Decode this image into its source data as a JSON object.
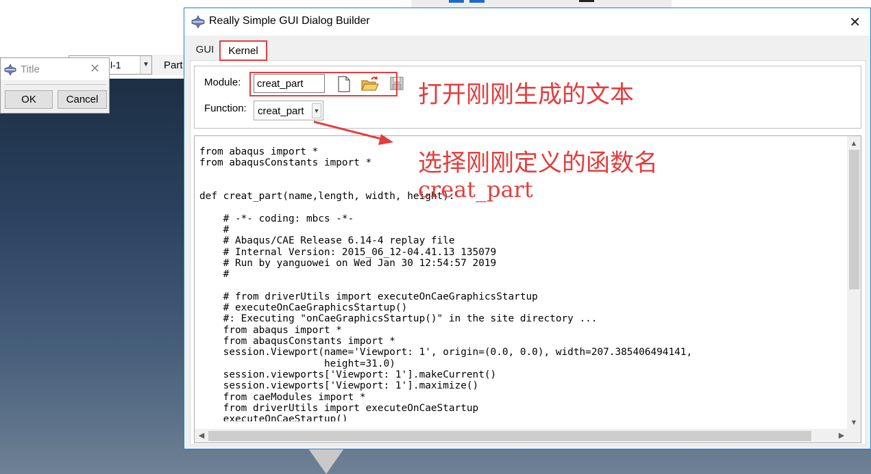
{
  "background": {
    "combo_value": "l-1",
    "part_label": "Part"
  },
  "small_dialog": {
    "title": "Title",
    "close_glyph": "✕",
    "ok_label": "OK",
    "cancel_label": "Cancel"
  },
  "main_dialog": {
    "title": "Really Simple GUI Dialog Builder",
    "close_glyph": "✕",
    "tabs": [
      {
        "label": "GUI",
        "active": false
      },
      {
        "label": "Kernel",
        "active": true
      }
    ],
    "module": {
      "label": "Module:",
      "value": "creat_part",
      "icons": [
        "new-file-icon",
        "open-folder-icon",
        "save-icon"
      ]
    },
    "function": {
      "label": "Function:",
      "selected": "creat_part"
    },
    "code_lines": [
      "from abaqus import *",
      "from abaqusConstants import *",
      "",
      "",
      "def creat_part(name,length, width, height):",
      "",
      "    # -*- coding: mbcs -*-",
      "    #",
      "    # Abaqus/CAE Release 6.14-4 replay file",
      "    # Internal Version: 2015_06_12-04.41.13 135079",
      "    # Run by yanguowei on Wed Jan 30 12:54:57 2019",
      "    #",
      "",
      "    # from driverUtils import executeOnCaeGraphicsStartup",
      "    # executeOnCaeGraphicsStartup()",
      "    #: Executing \"onCaeGraphicsStartup()\" in the site directory ...",
      "    from abaqus import *",
      "    from abaqusConstants import *",
      "    session.Viewport(name='Viewport: 1', origin=(0.0, 0.0), width=207.385406494141,",
      "                     height=31.0)",
      "    session.viewports['Viewport: 1'].makeCurrent()",
      "    session.viewports['Viewport: 1'].maximize()",
      "    from caeModules import *",
      "    from driverUtils import executeOnCaeStartup",
      "    executeOnCaeStartup()"
    ]
  },
  "annotations": {
    "open_text": "打开刚刚生成的文本",
    "select_text_1": "选择刚刚定义的函数名",
    "select_text_2": "creat_part",
    "color": "#e53c3c"
  },
  "colors": {
    "accent_border": "#1883d7",
    "highlight": "#e53c3c",
    "dialog_bg": "#f0f0f0"
  }
}
